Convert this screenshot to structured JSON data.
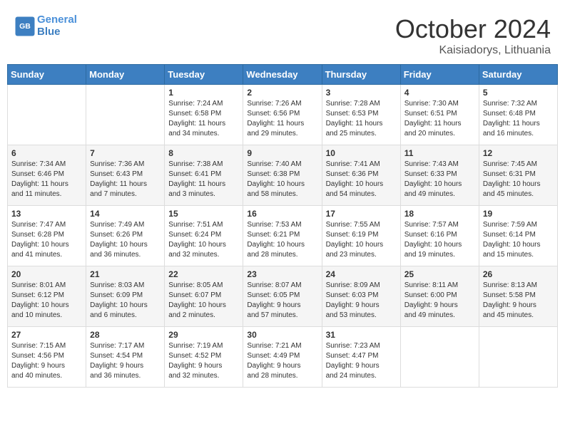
{
  "header": {
    "logo_line1": "General",
    "logo_line2": "Blue",
    "month": "October 2024",
    "location": "Kaisiadorys, Lithuania"
  },
  "days_of_week": [
    "Sunday",
    "Monday",
    "Tuesday",
    "Wednesday",
    "Thursday",
    "Friday",
    "Saturday"
  ],
  "weeks": [
    [
      {
        "day": "",
        "content": ""
      },
      {
        "day": "",
        "content": ""
      },
      {
        "day": "1",
        "content": "Sunrise: 7:24 AM\nSunset: 6:58 PM\nDaylight: 11 hours\nand 34 minutes."
      },
      {
        "day": "2",
        "content": "Sunrise: 7:26 AM\nSunset: 6:56 PM\nDaylight: 11 hours\nand 29 minutes."
      },
      {
        "day": "3",
        "content": "Sunrise: 7:28 AM\nSunset: 6:53 PM\nDaylight: 11 hours\nand 25 minutes."
      },
      {
        "day": "4",
        "content": "Sunrise: 7:30 AM\nSunset: 6:51 PM\nDaylight: 11 hours\nand 20 minutes."
      },
      {
        "day": "5",
        "content": "Sunrise: 7:32 AM\nSunset: 6:48 PM\nDaylight: 11 hours\nand 16 minutes."
      }
    ],
    [
      {
        "day": "6",
        "content": "Sunrise: 7:34 AM\nSunset: 6:46 PM\nDaylight: 11 hours\nand 11 minutes."
      },
      {
        "day": "7",
        "content": "Sunrise: 7:36 AM\nSunset: 6:43 PM\nDaylight: 11 hours\nand 7 minutes."
      },
      {
        "day": "8",
        "content": "Sunrise: 7:38 AM\nSunset: 6:41 PM\nDaylight: 11 hours\nand 3 minutes."
      },
      {
        "day": "9",
        "content": "Sunrise: 7:40 AM\nSunset: 6:38 PM\nDaylight: 10 hours\nand 58 minutes."
      },
      {
        "day": "10",
        "content": "Sunrise: 7:41 AM\nSunset: 6:36 PM\nDaylight: 10 hours\nand 54 minutes."
      },
      {
        "day": "11",
        "content": "Sunrise: 7:43 AM\nSunset: 6:33 PM\nDaylight: 10 hours\nand 49 minutes."
      },
      {
        "day": "12",
        "content": "Sunrise: 7:45 AM\nSunset: 6:31 PM\nDaylight: 10 hours\nand 45 minutes."
      }
    ],
    [
      {
        "day": "13",
        "content": "Sunrise: 7:47 AM\nSunset: 6:28 PM\nDaylight: 10 hours\nand 41 minutes."
      },
      {
        "day": "14",
        "content": "Sunrise: 7:49 AM\nSunset: 6:26 PM\nDaylight: 10 hours\nand 36 minutes."
      },
      {
        "day": "15",
        "content": "Sunrise: 7:51 AM\nSunset: 6:24 PM\nDaylight: 10 hours\nand 32 minutes."
      },
      {
        "day": "16",
        "content": "Sunrise: 7:53 AM\nSunset: 6:21 PM\nDaylight: 10 hours\nand 28 minutes."
      },
      {
        "day": "17",
        "content": "Sunrise: 7:55 AM\nSunset: 6:19 PM\nDaylight: 10 hours\nand 23 minutes."
      },
      {
        "day": "18",
        "content": "Sunrise: 7:57 AM\nSunset: 6:16 PM\nDaylight: 10 hours\nand 19 minutes."
      },
      {
        "day": "19",
        "content": "Sunrise: 7:59 AM\nSunset: 6:14 PM\nDaylight: 10 hours\nand 15 minutes."
      }
    ],
    [
      {
        "day": "20",
        "content": "Sunrise: 8:01 AM\nSunset: 6:12 PM\nDaylight: 10 hours\nand 10 minutes."
      },
      {
        "day": "21",
        "content": "Sunrise: 8:03 AM\nSunset: 6:09 PM\nDaylight: 10 hours\nand 6 minutes."
      },
      {
        "day": "22",
        "content": "Sunrise: 8:05 AM\nSunset: 6:07 PM\nDaylight: 10 hours\nand 2 minutes."
      },
      {
        "day": "23",
        "content": "Sunrise: 8:07 AM\nSunset: 6:05 PM\nDaylight: 9 hours\nand 57 minutes."
      },
      {
        "day": "24",
        "content": "Sunrise: 8:09 AM\nSunset: 6:03 PM\nDaylight: 9 hours\nand 53 minutes."
      },
      {
        "day": "25",
        "content": "Sunrise: 8:11 AM\nSunset: 6:00 PM\nDaylight: 9 hours\nand 49 minutes."
      },
      {
        "day": "26",
        "content": "Sunrise: 8:13 AM\nSunset: 5:58 PM\nDaylight: 9 hours\nand 45 minutes."
      }
    ],
    [
      {
        "day": "27",
        "content": "Sunrise: 7:15 AM\nSunset: 4:56 PM\nDaylight: 9 hours\nand 40 minutes."
      },
      {
        "day": "28",
        "content": "Sunrise: 7:17 AM\nSunset: 4:54 PM\nDaylight: 9 hours\nand 36 minutes."
      },
      {
        "day": "29",
        "content": "Sunrise: 7:19 AM\nSunset: 4:52 PM\nDaylight: 9 hours\nand 32 minutes."
      },
      {
        "day": "30",
        "content": "Sunrise: 7:21 AM\nSunset: 4:49 PM\nDaylight: 9 hours\nand 28 minutes."
      },
      {
        "day": "31",
        "content": "Sunrise: 7:23 AM\nSunset: 4:47 PM\nDaylight: 9 hours\nand 24 minutes."
      },
      {
        "day": "",
        "content": ""
      },
      {
        "day": "",
        "content": ""
      }
    ]
  ]
}
